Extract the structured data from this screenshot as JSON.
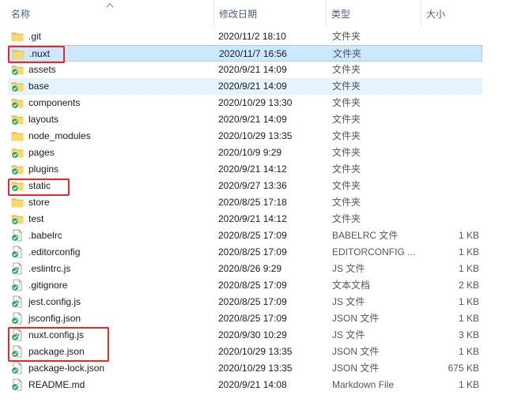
{
  "columns": {
    "name": "名称",
    "date": "修改日期",
    "type": "类型",
    "size": "大小"
  },
  "colors": {
    "folder": "#f5c84c",
    "check": "#2da44e",
    "highlight": "#e8272a",
    "selected": "#cce8ff"
  },
  "files": [
    {
      "name": ".git",
      "date": "2020/11/2 18:10",
      "type": "文件夹",
      "size": "",
      "icon": "folder-icon",
      "badge": false
    },
    {
      "name": ".nuxt",
      "date": "2020/11/7 16:56",
      "type": "文件夹",
      "size": "",
      "icon": "folder-icon",
      "badge": false
    },
    {
      "name": "assets",
      "date": "2020/9/21 14:09",
      "type": "文件夹",
      "size": "",
      "icon": "folder-icon",
      "badge": true
    },
    {
      "name": "base",
      "date": "2020/9/21 14:09",
      "type": "文件夹",
      "size": "",
      "icon": "folder-icon",
      "badge": true
    },
    {
      "name": "components",
      "date": "2020/10/29 13:30",
      "type": "文件夹",
      "size": "",
      "icon": "folder-icon",
      "badge": true
    },
    {
      "name": "layouts",
      "date": "2020/9/21 14:09",
      "type": "文件夹",
      "size": "",
      "icon": "folder-icon",
      "badge": true
    },
    {
      "name": "node_modules",
      "date": "2020/10/29 13:35",
      "type": "文件夹",
      "size": "",
      "icon": "folder-icon",
      "badge": false
    },
    {
      "name": "pages",
      "date": "2020/10/9 9:29",
      "type": "文件夹",
      "size": "",
      "icon": "folder-icon",
      "badge": true
    },
    {
      "name": "plugins",
      "date": "2020/9/21 14:12",
      "type": "文件夹",
      "size": "",
      "icon": "folder-icon",
      "badge": true
    },
    {
      "name": "static",
      "date": "2020/9/27 13:36",
      "type": "文件夹",
      "size": "",
      "icon": "folder-icon",
      "badge": true
    },
    {
      "name": "store",
      "date": "2020/8/25 17:18",
      "type": "文件夹",
      "size": "",
      "icon": "folder-icon",
      "badge": false
    },
    {
      "name": "test",
      "date": "2020/9/21 14:12",
      "type": "文件夹",
      "size": "",
      "icon": "folder-icon",
      "badge": true
    },
    {
      "name": ".babelrc",
      "date": "2020/8/25 17:09",
      "type": "BABELRC 文件",
      "size": "1 KB",
      "icon": "file-icon",
      "badge": true
    },
    {
      "name": ".editorconfig",
      "date": "2020/8/25 17:09",
      "type": "EDITORCONFIG ...",
      "size": "1 KB",
      "icon": "file-icon",
      "badge": true
    },
    {
      "name": ".eslintrc.js",
      "date": "2020/8/26 9:29",
      "type": "JS 文件",
      "size": "1 KB",
      "icon": "script-file-icon",
      "badge": true
    },
    {
      "name": ".gitignore",
      "date": "2020/8/25 17:09",
      "type": "文本文档",
      "size": "2 KB",
      "icon": "file-icon",
      "badge": true
    },
    {
      "name": "jest.config.js",
      "date": "2020/8/25 17:09",
      "type": "JS 文件",
      "size": "1 KB",
      "icon": "script-file-icon",
      "badge": true
    },
    {
      "name": "jsconfig.json",
      "date": "2020/8/25 17:09",
      "type": "JSON 文件",
      "size": "1 KB",
      "icon": "file-icon",
      "badge": true
    },
    {
      "name": "nuxt.config.js",
      "date": "2020/9/30 10:29",
      "type": "JS 文件",
      "size": "3 KB",
      "icon": "script-file-icon",
      "badge": true
    },
    {
      "name": "package.json",
      "date": "2020/10/29 13:35",
      "type": "JSON 文件",
      "size": "1 KB",
      "icon": "file-icon",
      "badge": true
    },
    {
      "name": "package-lock.json",
      "date": "2020/10/29 13:35",
      "type": "JSON 文件",
      "size": "675 KB",
      "icon": "file-icon",
      "badge": true
    },
    {
      "name": "README.md",
      "date": "2020/9/21 14:08",
      "type": "Markdown File",
      "size": "1 KB",
      "icon": "file-icon",
      "badge": true
    }
  ],
  "selected_row": 1,
  "hover_row": 3
}
